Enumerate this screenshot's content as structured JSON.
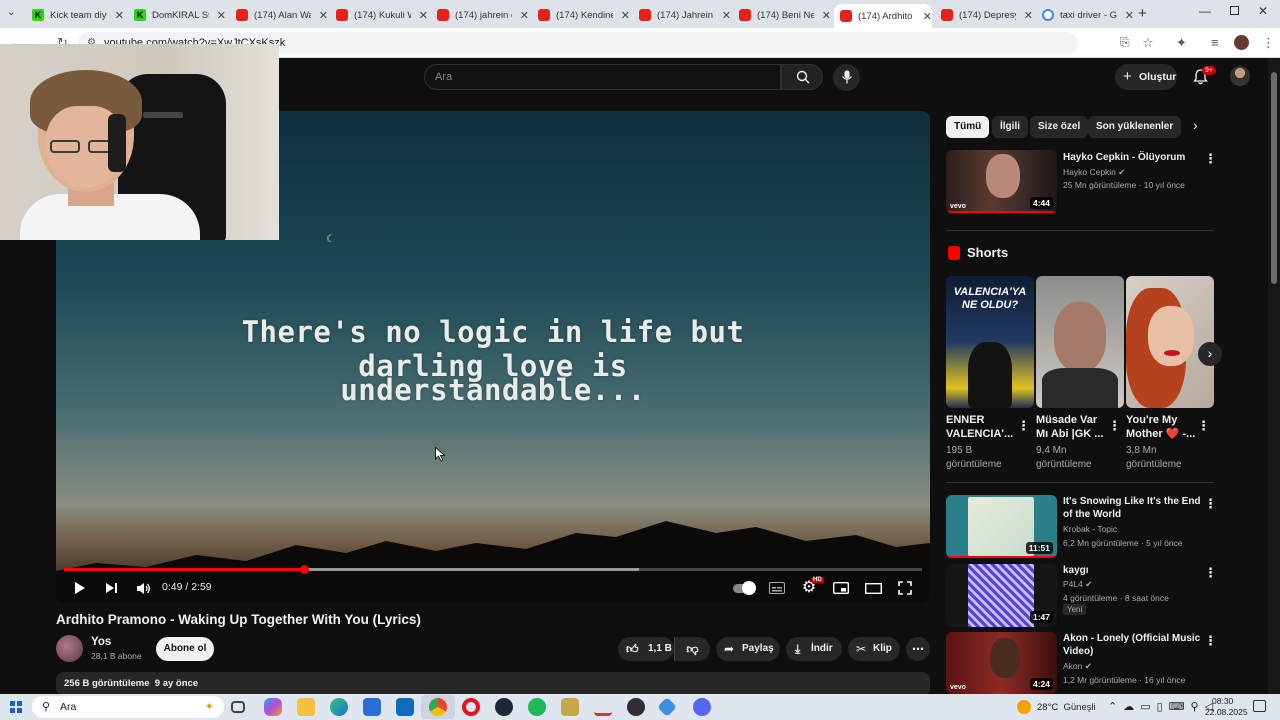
{
  "browser": {
    "tabs": [
      {
        "title": "Kick team diyo",
        "icon": "kick-icon"
      },
      {
        "title": "DomKIRAL Stre",
        "icon": "kick-icon"
      },
      {
        "title": "(174) Alan Wa",
        "icon": "youtube-icon"
      },
      {
        "title": "(174) Kukuli W",
        "icon": "youtube-icon"
      },
      {
        "title": "(174) jahrein d",
        "icon": "youtube-icon"
      },
      {
        "title": "(174) Kendine",
        "icon": "youtube-icon"
      },
      {
        "title": "(174) Jahrein -",
        "icon": "youtube-icon"
      },
      {
        "title": "(174) Beni Ne",
        "icon": "youtube-icon"
      },
      {
        "title": "(174) Ardhito",
        "icon": "youtube-icon"
      },
      {
        "title": "(174) Depresy",
        "icon": "youtube-icon"
      },
      {
        "title": "taxi driver - Go",
        "icon": "google-icon"
      }
    ],
    "url": "youtube.com/watch?v=XwJtCXsKszk"
  },
  "header": {
    "search_placeholder": "Ara",
    "create_label": "Oluştur",
    "notifications_badge": "9+"
  },
  "player": {
    "lyric_line1": "There's no logic in life but darling love is",
    "lyric_line2": "understandable...",
    "time": "0:49 / 2:59",
    "progress_played": 0.28,
    "progress_loaded": 0.67,
    "settings_badge": "HD"
  },
  "video": {
    "title": "Ardhito Pramono - Waking Up Together With You (Lyrics)",
    "channel": "Yos",
    "subscribers": "28,1 B abone",
    "subscribe_label": "Abone ol",
    "likes": "1,1 B",
    "share_label": "Paylaş",
    "download_label": "İndir",
    "clip_label": "Klip",
    "views_date": "256 B görüntüleme  9 ay önce"
  },
  "chips": [
    "Tümü",
    "İlgili",
    "Size özel",
    "Son yüklenenler"
  ],
  "recommended_top": {
    "title": "Hayko Cepkin - Ölüyorum",
    "channel": "Hayko Cepkin",
    "meta": "25 Mn görüntüleme · 10 yıl önce",
    "duration": "4:44"
  },
  "shorts": {
    "heading": "Shorts",
    "items": [
      {
        "title": "ENNER VALENCIA'...",
        "views": "195 B görüntüleme",
        "overlay": "VALENCIA'YA NE OLDU?"
      },
      {
        "title": "Müsade Var Mı Abi |GK ...",
        "views": "9,4 Mn görüntüleme"
      },
      {
        "title": "You're My Mother ❤️ -...",
        "views": "3,8 Mn görüntüleme"
      }
    ]
  },
  "recommended": [
    {
      "title": "It's Snowing Like It's the End of the World",
      "channel": "Krobak - Topic",
      "meta": "6,2 Mn görüntüleme · 5 yıl önce",
      "duration": "11:51"
    },
    {
      "title": "kaygı",
      "channel": "P4L4",
      "meta": "4 görüntüleme · 8 saat önce",
      "badge": "Yeni",
      "duration": "1:47"
    },
    {
      "title": "Akon - Lonely (Official Music Video)",
      "channel": "Akon",
      "meta": "1,2 Mr görüntüleme · 16 yıl önce",
      "duration": "4:24"
    }
  ],
  "taskbar": {
    "search_placeholder": "Ara",
    "weather": "28°C  Güneşli",
    "time": "08:30",
    "date": "22.08.2025"
  }
}
